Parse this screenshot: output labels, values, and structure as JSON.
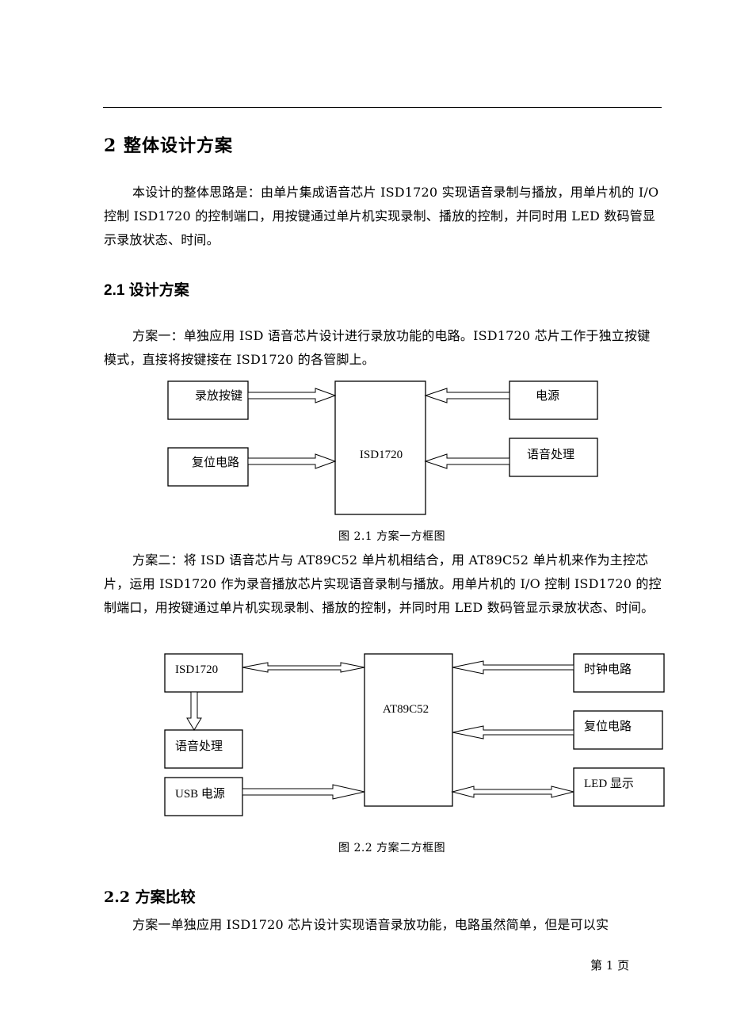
{
  "section": {
    "title": "2  整体设计方案",
    "intro": "本设计的整体思路是：由单片集成语音芯片 ISD1720 实现语音录制与播放，用单片机的 I/O 控制 ISD1720 的控制端口，用按键通过单片机实现录制、播放的控制，并同时用 LED 数码管显示录放状态、时间。"
  },
  "subsection_1": {
    "title": "2.1  设计方案",
    "scheme1_text": "方案一：单独应用 ISD 语音芯片设计进行录放功能的电路。ISD1720 芯片工作于独立按键模式，直接将按键接在 ISD1720 的各管脚上。",
    "figure1": {
      "caption": "图 2.1    方案一方框图",
      "center": "ISD1720",
      "left_blocks": [
        "录放按键",
        "复位电路"
      ],
      "right_blocks": [
        "电源",
        "语音处理"
      ]
    },
    "scheme2_text": "方案二：将 ISD 语音芯片与 AT89C52 单片机相结合，用 AT89C52 单片机来作为主控芯片，运用 ISD1720 作为录音播放芯片实现语音录制与播放。用单片机的 I/O 控制 ISD1720 的控制端口，用按键通过单片机实现录制、播放的控制，并同时用 LED 数码管显示录放状态、时间。",
    "figure2": {
      "caption": "图 2.2    方案二方框图",
      "center": "AT89C52",
      "left_blocks": [
        "ISD1720",
        "语音处理",
        "USB 电源"
      ],
      "right_blocks": [
        "时钟电路",
        "复位电路",
        "LED 显示"
      ]
    }
  },
  "subsection_2": {
    "title": "2.2 方案比较",
    "text": "方案一单独应用 ISD1720 芯片设计实现语音录放功能，电路虽然简单，但是可以实"
  },
  "footer": {
    "page": "第 1 页"
  }
}
